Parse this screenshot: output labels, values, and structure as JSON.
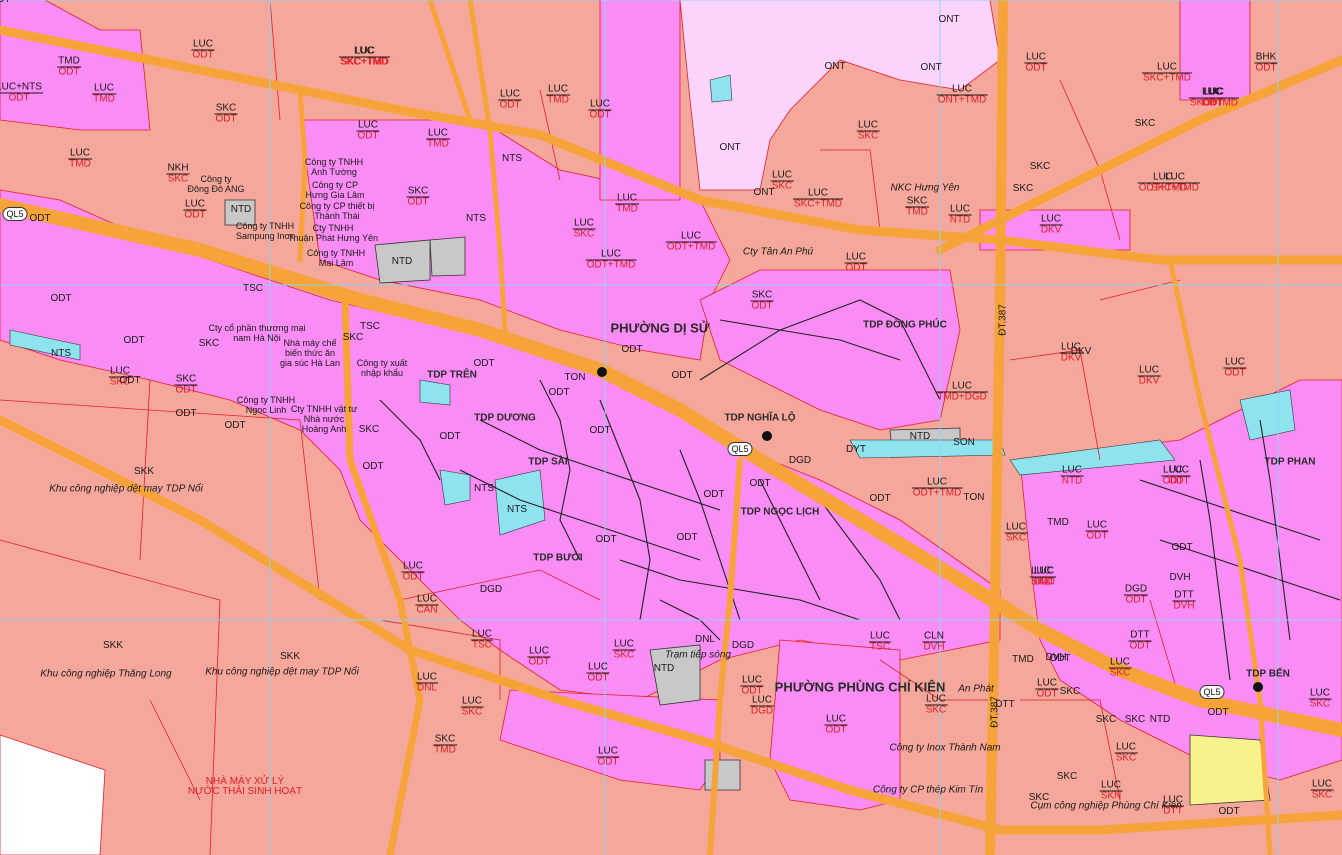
{
  "colors": {
    "odt": "#f98cf5",
    "luc": "#f4a79a",
    "ont": "#fbd3fb",
    "ntd": "#c8c8c8",
    "nts": "#8fe3ee",
    "road": "#f6a43a",
    "grid": "#8fd3f0",
    "boundary": "#e0202a",
    "dgd_yellow": "#f7f28c"
  },
  "districts": [
    {
      "id": "d1",
      "text": "PHƯỜNG DỊ SỬ",
      "size": "big"
    },
    {
      "id": "d2",
      "text": "PHƯỜNG PHÙNG CHÍ KIÊN",
      "size": "big"
    },
    {
      "id": "d3",
      "text": "TDP TRÊN",
      "size": "small"
    },
    {
      "id": "d4",
      "text": "TDP DƯƠNG",
      "size": "small"
    },
    {
      "id": "d5",
      "text": "TDP SÀI",
      "size": "small"
    },
    {
      "id": "d6",
      "text": "TDP BƯỞI",
      "size": "small"
    },
    {
      "id": "d7",
      "text": "TDP NGHĨA LỘ",
      "size": "small"
    },
    {
      "id": "d8",
      "text": "TDP NGỌC LỊCH",
      "size": "small"
    },
    {
      "id": "d9",
      "text": "TDP PHAN",
      "size": "small"
    },
    {
      "id": "d10",
      "text": "TDP BẾN",
      "size": "small"
    },
    {
      "id": "d11",
      "text": "TDP ĐÔNG PHÚC",
      "size": "small"
    }
  ],
  "roads": [
    {
      "id": "r1",
      "text": "ĐT.387"
    },
    {
      "id": "r2",
      "text": "ĐT.387"
    }
  ],
  "shields": [
    {
      "id": "s1",
      "text": "QL5"
    },
    {
      "id": "s2",
      "text": "QL5"
    },
    {
      "id": "s3",
      "text": "QL5"
    }
  ],
  "places": [
    {
      "id": "p1",
      "text": "Khu công nghiệp dệt may TDP Nổi"
    },
    {
      "id": "p2",
      "text": "Khu công nghiệp Thăng Long"
    },
    {
      "id": "p3",
      "text": "Khu công nghiệp dệt may TDP Nổi"
    },
    {
      "id": "p4",
      "text": "Cụm công nghiệp Phùng Chí Kiên"
    },
    {
      "id": "p5",
      "text": "Trạm tiếp sóng"
    },
    {
      "id": "p6",
      "text": "Cty Tân An Phú"
    },
    {
      "id": "p7",
      "text": "Công ty Inox Thành Nam"
    },
    {
      "id": "p8",
      "text": "Công ty CP thép Kim Tín"
    },
    {
      "id": "p9",
      "text": "An Phát"
    },
    {
      "id": "p10",
      "text": "NKC Hưng Yên"
    }
  ],
  "companies": [
    {
      "id": "c1",
      "text": "Công ty TNHH\nAnh Tường"
    },
    {
      "id": "c2",
      "text": "Công ty CP\nHưng Gia Lâm"
    },
    {
      "id": "c3",
      "text": "Công ty CP thiết bị\nThành Thái"
    },
    {
      "id": "c4",
      "text": "Cty TNHH\nThuận Phát Hưng Yên"
    },
    {
      "id": "c5",
      "text": "Công ty TNHH\nMai Lâm"
    },
    {
      "id": "c6",
      "text": "Công ty\nĐông Đô ANG"
    },
    {
      "id": "c7",
      "text": "Công ty TNHH\nSampung Inox"
    },
    {
      "id": "c8",
      "text": "Cty cổ phần thương mại\nnam Hà Nội"
    },
    {
      "id": "c9",
      "text": "Nhà máy chế\nbiến thức ăn\ngia súc Hà Lan"
    },
    {
      "id": "c10",
      "text": "Công ty xuất\nnhập khẩu"
    },
    {
      "id": "c11",
      "text": "Công ty TNHH\nNgọc Linh"
    },
    {
      "id": "c12",
      "text": "Cty TNHH vật tư\nNhà nước\nHoàng Anh"
    }
  ],
  "special_labels": [
    {
      "id": "x1",
      "top": "NHÀ MÁY XỬ LÝ",
      "bot": "NƯỚC THẢI SINH HOẠT"
    }
  ],
  "parcels": [
    {
      "id": "l1",
      "top": "LUC",
      "bot": "ODT"
    },
    {
      "id": "l2",
      "top": "LUC",
      "bot": "SKC+TMD"
    },
    {
      "id": "l3",
      "top": "TMD",
      "bot": "ODT"
    },
    {
      "id": "l4",
      "top": "LUC",
      "bot": "TMD"
    },
    {
      "id": "l5",
      "top": "SKC",
      "bot": "ODT"
    },
    {
      "id": "l6",
      "top": "LUC",
      "bot": "TMD"
    },
    {
      "id": "l7",
      "top": "LUC",
      "bot": "ODT"
    },
    {
      "id": "l8",
      "top": "NKH",
      "bot": "SKC"
    },
    {
      "id": "l9",
      "top": "LUC",
      "bot": "ODT"
    },
    {
      "id": "l10",
      "top": "LUC",
      "bot": "TMD"
    },
    {
      "id": "l11",
      "top": "LUC",
      "bot": "ODT"
    },
    {
      "id": "l12",
      "top": "LUC",
      "bot": "TMD"
    },
    {
      "id": "l13",
      "top": "LUC",
      "bot": "ODT"
    },
    {
      "id": "l14",
      "top": "SKC",
      "bot": "ODT"
    },
    {
      "id": "l15",
      "top": "LUC",
      "bot": "TMD"
    },
    {
      "id": "l16",
      "top": "LUC",
      "bot": "ODT+TMD"
    },
    {
      "id": "l17",
      "top": "LUC",
      "bot": "SKC"
    },
    {
      "id": "l18",
      "top": "LUC",
      "bot": "SKC+TMD"
    },
    {
      "id": "l19",
      "top": "SKC",
      "bot": "TMD"
    },
    {
      "id": "l20",
      "top": "LUC",
      "bot": "ODT"
    },
    {
      "id": "l21",
      "top": "SKC",
      "bot": "ODT"
    },
    {
      "id": "l22",
      "top": "LUC",
      "bot": "ODT+TMD"
    },
    {
      "id": "l23",
      "top": "LUC",
      "bot": "SKC"
    },
    {
      "id": "l24",
      "top": "LUC",
      "bot": "SKC"
    },
    {
      "id": "l25",
      "top": "LUC",
      "bot": "ODT"
    },
    {
      "id": "l26",
      "top": "LUC",
      "bot": "SKC+TMD"
    },
    {
      "id": "l27",
      "top": "LUC",
      "bot": "DKV"
    },
    {
      "id": "l28",
      "top": "LUC",
      "bot": "DKV"
    },
    {
      "id": "l29",
      "top": "LUC",
      "bot": "DKV"
    },
    {
      "id": "l30",
      "top": "LUC",
      "bot": "ODT"
    },
    {
      "id": "l31",
      "top": "LUC",
      "bot": "ODT"
    },
    {
      "id": "l32",
      "top": "LUC",
      "bot": "ODT+TMD"
    },
    {
      "id": "l33",
      "top": "LUC",
      "bot": "SKC+TMD"
    },
    {
      "id": "l34",
      "top": "LUC",
      "bot": "TMD+DGD"
    },
    {
      "id": "l35",
      "top": "LUC",
      "bot": "ODT+TMD"
    },
    {
      "id": "l36",
      "top": "LUC",
      "bot": "SKC"
    },
    {
      "id": "l37",
      "top": "LUC",
      "bot": "ODT"
    },
    {
      "id": "l38",
      "top": "LUC",
      "bot": "ODT"
    },
    {
      "id": "l39",
      "top": "DGD",
      "bot": "ODT"
    },
    {
      "id": "l40",
      "top": "DTT",
      "bot": "DVH"
    },
    {
      "id": "l41",
      "top": "LUC",
      "bot": "ODT"
    },
    {
      "id": "l42",
      "top": "LUC",
      "bot": "CAN"
    },
    {
      "id": "l43",
      "top": "LUC",
      "bot": "TSC"
    },
    {
      "id": "l44",
      "top": "LUC",
      "bot": "ODT"
    },
    {
      "id": "l45",
      "top": "LUC",
      "bot": "ODT"
    },
    {
      "id": "l46",
      "top": "LUC",
      "bot": "DNL"
    },
    {
      "id": "l47",
      "top": "LUC",
      "bot": "SKC"
    },
    {
      "id": "l48",
      "top": "SKC",
      "bot": "TMD"
    },
    {
      "id": "l49",
      "top": "LUC",
      "bot": "ODT"
    },
    {
      "id": "l50",
      "top": "LUC",
      "bot": "SKC"
    },
    {
      "id": "l51",
      "top": "LUC",
      "bot": "ODT"
    },
    {
      "id": "l52",
      "top": "LUC",
      "bot": "DGD"
    },
    {
      "id": "l53",
      "top": "LUC",
      "bot": "TSC"
    },
    {
      "id": "l54",
      "top": "LUC",
      "bot": "ODT"
    },
    {
      "id": "l55",
      "top": "CLN",
      "bot": "DVH"
    },
    {
      "id": "l56",
      "top": "LUC",
      "bot": "SKC"
    },
    {
      "id": "l57",
      "top": "LUC",
      "bot": "SKN"
    },
    {
      "id": "l58",
      "top": "LUC",
      "bot": "DTT"
    },
    {
      "id": "l59",
      "top": "LUC",
      "bot": "NTD"
    },
    {
      "id": "l60",
      "top": "LUC",
      "bot": "SKC"
    },
    {
      "id": "l61",
      "top": "LUC",
      "bot": "SKC"
    },
    {
      "id": "l62",
      "top": "LUC",
      "bot": "ODT"
    },
    {
      "id": "l63",
      "top": "LUC",
      "bot": "SKC"
    },
    {
      "id": "l64",
      "top": "LUC",
      "bot": "ODT"
    },
    {
      "id": "l65",
      "top": "DTT",
      "bot": "ODT"
    },
    {
      "id": "l66",
      "top": "LUC",
      "bot": "SKC"
    },
    {
      "id": "l67",
      "top": "LUC",
      "bot": "SKC"
    },
    {
      "id": "l68",
      "top": "LUC",
      "bot": "ODT"
    },
    {
      "id": "l69",
      "top": "LUC",
      "bot": "TMD"
    },
    {
      "id": "l70",
      "top": "LUC",
      "bot": "ODT"
    },
    {
      "id": "l71",
      "top": "LUC",
      "bot": "NTD"
    },
    {
      "id": "l72",
      "top": "BHK",
      "bot": "ODT"
    },
    {
      "id": "l73",
      "top": "LUC",
      "bot": "SKC+TMD"
    },
    {
      "id": "l74",
      "top": "LUC",
      "bot": "ONT+TMD"
    },
    {
      "id": "l75",
      "top": "LUC",
      "bot": "SKC+TMD"
    },
    {
      "id": "l76",
      "top": "LUC+NTS",
      "bot": "ODT"
    },
    {
      "id": "l77",
      "top": "LUC",
      "bot": "SKC"
    },
    {
      "id": "l78",
      "top": "SKC",
      "bot": "ODT"
    }
  ],
  "singles": [
    {
      "id": "t1",
      "text": "SKK"
    },
    {
      "id": "t2",
      "text": "SKK"
    },
    {
      "id": "t3",
      "text": "SKK"
    },
    {
      "id": "t4",
      "text": "ODT"
    },
    {
      "id": "t5",
      "text": "ODT"
    },
    {
      "id": "t6",
      "text": "ODT"
    },
    {
      "id": "t7",
      "text": "ODT"
    },
    {
      "id": "t8",
      "text": "ODT"
    },
    {
      "id": "t9",
      "text": "ODT"
    },
    {
      "id": "t10",
      "text": "ODT"
    },
    {
      "id": "t11",
      "text": "ODT"
    },
    {
      "id": "t12",
      "text": "ODT"
    },
    {
      "id": "t13",
      "text": "ODT"
    },
    {
      "id": "t14",
      "text": "ODT"
    },
    {
      "id": "t15",
      "text": "ODT"
    },
    {
      "id": "t16",
      "text": "ODT"
    },
    {
      "id": "t17",
      "text": "ODT"
    },
    {
      "id": "t18",
      "text": "ODT"
    },
    {
      "id": "t19",
      "text": "ODT"
    },
    {
      "id": "t20",
      "text": "ODT"
    },
    {
      "id": "t21",
      "text": "ODT"
    },
    {
      "id": "t22",
      "text": "ODT"
    },
    {
      "id": "t23",
      "text": "ODT"
    },
    {
      "id": "t24",
      "text": "ODT"
    },
    {
      "id": "t25",
      "text": "SKC"
    },
    {
      "id": "t26",
      "text": "SKC"
    },
    {
      "id": "t27",
      "text": "SKC"
    },
    {
      "id": "t28",
      "text": "SKC"
    },
    {
      "id": "t29",
      "text": "SKC"
    },
    {
      "id": "t30",
      "text": "SKC"
    },
    {
      "id": "t31",
      "text": "SKC"
    },
    {
      "id": "t32",
      "text": "SKC"
    },
    {
      "id": "t33",
      "text": "SKC"
    },
    {
      "id": "t34",
      "text": "NTD"
    },
    {
      "id": "t35",
      "text": "NTD"
    },
    {
      "id": "t36",
      "text": "NTD"
    },
    {
      "id": "t37",
      "text": "NTD"
    },
    {
      "id": "t38",
      "text": "NTD"
    },
    {
      "id": "t39",
      "text": "NTS"
    },
    {
      "id": "t40",
      "text": "NTS"
    },
    {
      "id": "t41",
      "text": "NTS"
    },
    {
      "id": "t42",
      "text": "NTS"
    },
    {
      "id": "t43",
      "text": "NTS"
    },
    {
      "id": "t44",
      "text": "ONT"
    },
    {
      "id": "t45",
      "text": "ONT"
    },
    {
      "id": "t46",
      "text": "ONT"
    },
    {
      "id": "t47",
      "text": "ONT"
    },
    {
      "id": "t48",
      "text": "ONT"
    },
    {
      "id": "t49",
      "text": "DNL"
    },
    {
      "id": "t50",
      "text": "DGD"
    },
    {
      "id": "t51",
      "text": "DGD"
    },
    {
      "id": "t52",
      "text": "DGD"
    },
    {
      "id": "t53",
      "text": "DYT"
    },
    {
      "id": "t54",
      "text": "TON"
    },
    {
      "id": "t55",
      "text": "TON"
    },
    {
      "id": "t56",
      "text": "SON"
    },
    {
      "id": "t57",
      "text": "TMD"
    },
    {
      "id": "t58",
      "text": "TMD"
    },
    {
      "id": "t59",
      "text": "TSC"
    },
    {
      "id": "t60",
      "text": "TSC"
    },
    {
      "id": "t61",
      "text": "DTT"
    },
    {
      "id": "t62",
      "text": "DKV"
    },
    {
      "id": "t63",
      "text": "DVH"
    },
    {
      "id": "t64",
      "text": "DVH"
    },
    {
      "id": "t65",
      "text": "SKC"
    },
    {
      "id": "t66",
      "text": "SKC"
    },
    {
      "id": "t67",
      "text": "ODT"
    },
    {
      "id": "t68",
      "text": "ODT"
    }
  ]
}
